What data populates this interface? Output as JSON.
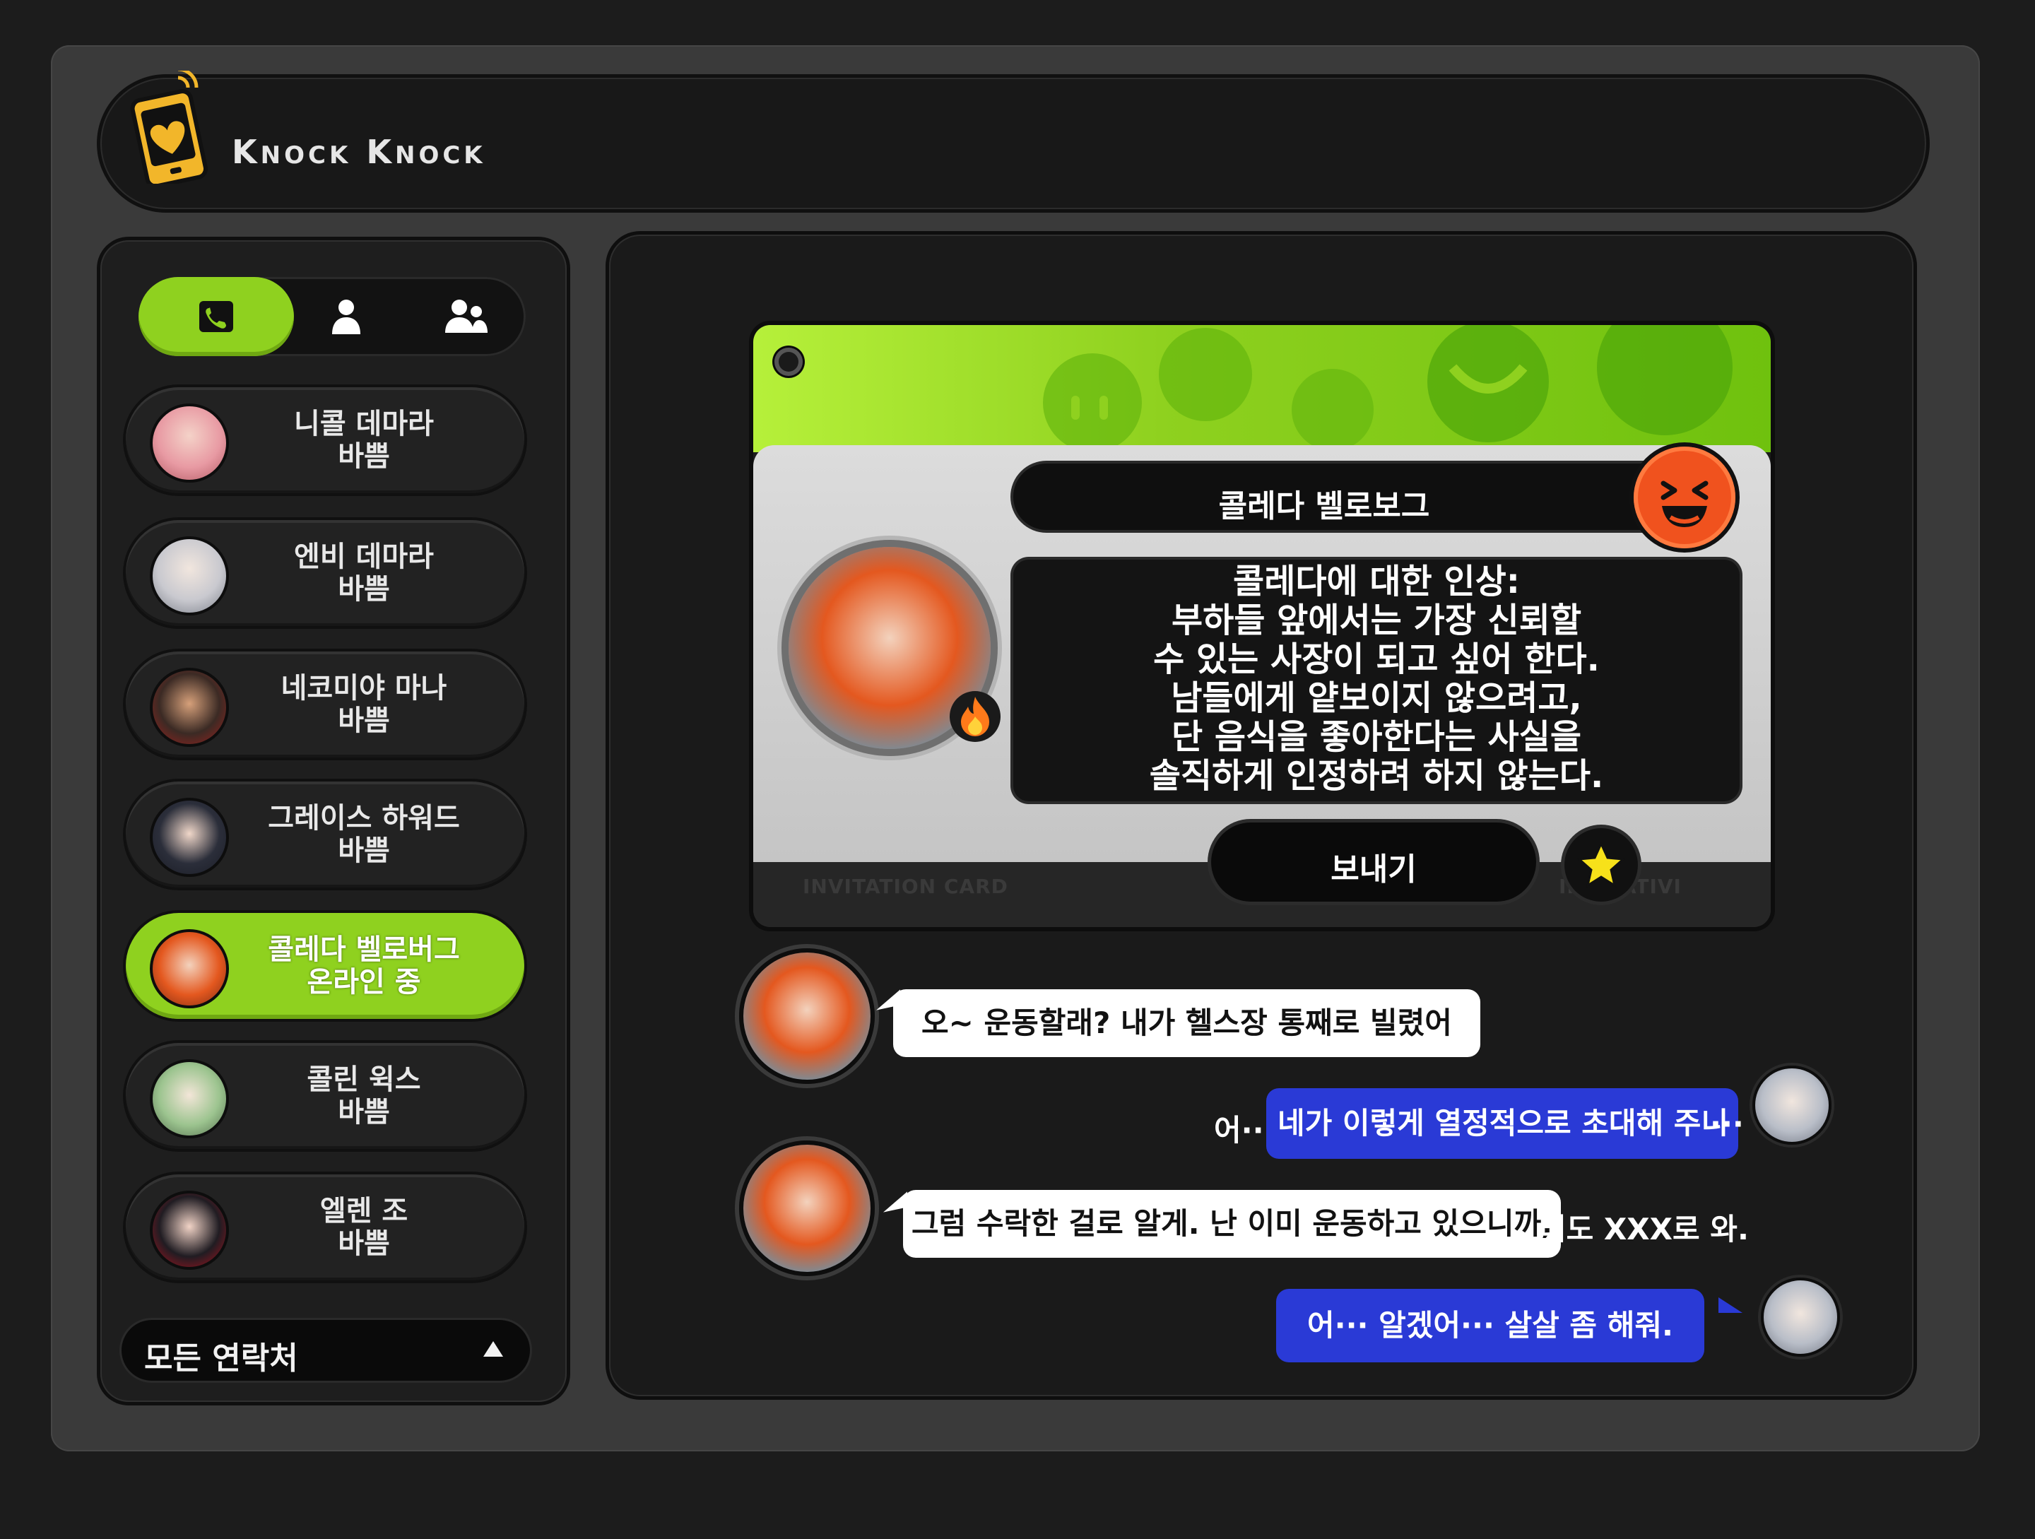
{
  "app": {
    "brand_k1": "K",
    "brand_rest1": "NOCK",
    "brand_k2": "K",
    "brand_rest2": "NOCK"
  },
  "colors": {
    "accent": "#8fd11f",
    "bubble_blue": "#2a3ad6",
    "badge_orange": "#f0521e",
    "logo_yellow": "#f2b62a"
  },
  "tabs": [
    {
      "icon": "phone-book-icon",
      "active": true
    },
    {
      "icon": "user-icon",
      "active": false
    },
    {
      "icon": "group-icon",
      "active": false
    }
  ],
  "contacts": [
    {
      "name": "니콜 데마라",
      "status": "바쁨",
      "active": false
    },
    {
      "name": "엔비 데마라",
      "status": "바쁨",
      "active": false
    },
    {
      "name": "네코미야 마나",
      "status": "바쁨",
      "active": false
    },
    {
      "name": "그레이스 하워드",
      "status": "바쁨",
      "active": false
    },
    {
      "name": "콜레다 벨로버그",
      "status": "온라인 중",
      "active": true
    },
    {
      "name": "콜린 윅스",
      "status": "바쁨",
      "active": false
    },
    {
      "name": "엘렌 조",
      "status": "바쁨",
      "active": false
    }
  ],
  "all_contacts_label": "모든 연락처",
  "card": {
    "name": "콜레다 벨로보그",
    "impression": "콜레다에 대한 인상:\n부하들 앞에서는 가장 신뢰할\n수 있는 사장이 되고 싶어 한다.\n남들에게 얕보이지 않으려고,\n단 음식을 좋아한다는 사실을\n솔직하게 인정하려 하지 않는다.",
    "send_label": "보내기",
    "footer_left": "INVITATION CARD",
    "footer_right": "INVITATIVI"
  },
  "messages": [
    {
      "from": "contact",
      "text": "오~ 운동할래? 내가 헬스장 통째로 빌렸어"
    },
    {
      "from": "me",
      "prefix": "어···",
      "text": "네가 이렇게 열정적으로 초대해 주니",
      "suffix": "···"
    },
    {
      "from": "contact",
      "text": "그럼 수락한 걸로 알게. 난 이미 운동하고 있으니까,",
      "suffix": "너도 XXX로 와."
    },
    {
      "from": "me",
      "text": "어··· 알겠어··· 살살 좀 해줘."
    }
  ]
}
